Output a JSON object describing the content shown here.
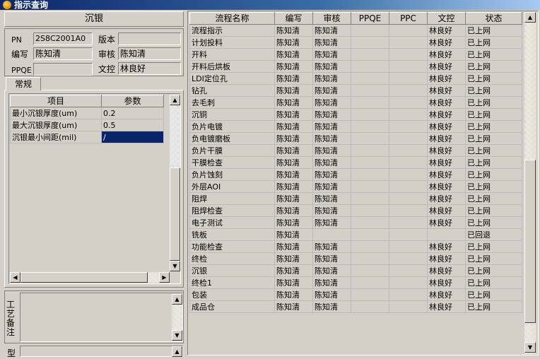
{
  "window": {
    "title": "指示查询"
  },
  "left": {
    "header": "沉银",
    "pn_label": "PN",
    "pn_value": "2S8C2001A0",
    "version_label": "版本",
    "version_value": "",
    "writer_label": "编写",
    "writer_value": "陈知清",
    "reviewer_label": "审核",
    "reviewer_value": "陈知清",
    "ppqe_label": "PPQE",
    "ppqe_value": "",
    "qc_label": "文控",
    "qc_value": "林良好",
    "tab_general": "常规",
    "param_columns": [
      "项目",
      "参数"
    ],
    "params": [
      {
        "item": "最小沉银厚度(um)",
        "value": "0.2"
      },
      {
        "item": "最大沉银厚度(um)",
        "value": "0.5"
      },
      {
        "item": "沉银最小间距(mil)",
        "value": "/"
      }
    ],
    "remarks_label": "工艺备注",
    "model_label": "型"
  },
  "flow": {
    "columns": [
      "流程名称",
      "编写",
      "审核",
      "PPQE",
      "PPC",
      "文控",
      "状态"
    ],
    "rows": [
      {
        "name": "流程指示",
        "writer": "陈知清",
        "reviewer": "陈知清",
        "ppqe": "",
        "ppc": "",
        "qc": "林良好",
        "status": "已上网"
      },
      {
        "name": "计划投料",
        "writer": "陈知清",
        "reviewer": "陈知清",
        "ppqe": "",
        "ppc": "",
        "qc": "林良好",
        "status": "已上网"
      },
      {
        "name": "开料",
        "writer": "陈知清",
        "reviewer": "陈知清",
        "ppqe": "",
        "ppc": "",
        "qc": "林良好",
        "status": "已上网"
      },
      {
        "name": "开料后烘板",
        "writer": "陈知清",
        "reviewer": "陈知清",
        "ppqe": "",
        "ppc": "",
        "qc": "林良好",
        "status": "已上网"
      },
      {
        "name": "LDI定位孔",
        "writer": "陈知清",
        "reviewer": "陈知清",
        "ppqe": "",
        "ppc": "",
        "qc": "林良好",
        "status": "已上网"
      },
      {
        "name": "钻孔",
        "writer": "陈知清",
        "reviewer": "陈知清",
        "ppqe": "",
        "ppc": "",
        "qc": "林良好",
        "status": "已上网"
      },
      {
        "name": "去毛刺",
        "writer": "陈知清",
        "reviewer": "陈知清",
        "ppqe": "",
        "ppc": "",
        "qc": "林良好",
        "status": "已上网"
      },
      {
        "name": "沉铜",
        "writer": "陈知清",
        "reviewer": "陈知清",
        "ppqe": "",
        "ppc": "",
        "qc": "林良好",
        "status": "已上网"
      },
      {
        "name": "负片电镀",
        "writer": "陈知清",
        "reviewer": "陈知清",
        "ppqe": "",
        "ppc": "",
        "qc": "林良好",
        "status": "已上网"
      },
      {
        "name": "负电镀磨板",
        "writer": "陈知清",
        "reviewer": "陈知清",
        "ppqe": "",
        "ppc": "",
        "qc": "林良好",
        "status": "已上网"
      },
      {
        "name": "负片干膜",
        "writer": "陈知清",
        "reviewer": "陈知清",
        "ppqe": "",
        "ppc": "",
        "qc": "林良好",
        "status": "已上网"
      },
      {
        "name": "干膜检查",
        "writer": "陈知清",
        "reviewer": "陈知清",
        "ppqe": "",
        "ppc": "",
        "qc": "林良好",
        "status": "已上网"
      },
      {
        "name": "负片蚀刻",
        "writer": "陈知清",
        "reviewer": "陈知清",
        "ppqe": "",
        "ppc": "",
        "qc": "林良好",
        "status": "已上网"
      },
      {
        "name": "外层AOI",
        "writer": "陈知清",
        "reviewer": "陈知清",
        "ppqe": "",
        "ppc": "",
        "qc": "林良好",
        "status": "已上网"
      },
      {
        "name": "阻焊",
        "writer": "陈知清",
        "reviewer": "陈知清",
        "ppqe": "",
        "ppc": "",
        "qc": "林良好",
        "status": "已上网"
      },
      {
        "name": "阻焊检查",
        "writer": "陈知清",
        "reviewer": "陈知清",
        "ppqe": "",
        "ppc": "",
        "qc": "林良好",
        "status": "已上网"
      },
      {
        "name": "电子测试",
        "writer": "陈知清",
        "reviewer": "陈知清",
        "ppqe": "",
        "ppc": "",
        "qc": "林良好",
        "status": "已上网"
      },
      {
        "name": "铣板",
        "writer": "陈知清",
        "reviewer": "",
        "ppqe": "",
        "ppc": "",
        "qc": "",
        "status": "已回退"
      },
      {
        "name": "功能检查",
        "writer": "陈知清",
        "reviewer": "陈知清",
        "ppqe": "",
        "ppc": "",
        "qc": "林良好",
        "status": "已上网"
      },
      {
        "name": "终检",
        "writer": "陈知清",
        "reviewer": "陈知清",
        "ppqe": "",
        "ppc": "",
        "qc": "林良好",
        "status": "已上网"
      },
      {
        "name": "沉银",
        "writer": "陈知清",
        "reviewer": "陈知清",
        "ppqe": "",
        "ppc": "",
        "qc": "林良好",
        "status": "已上网"
      },
      {
        "name": "终检1",
        "writer": "陈知清",
        "reviewer": "陈知清",
        "ppqe": "",
        "ppc": "",
        "qc": "林良好",
        "status": "已上网"
      },
      {
        "name": "包装",
        "writer": "陈知清",
        "reviewer": "陈知清",
        "ppqe": "",
        "ppc": "",
        "qc": "林良好",
        "status": "已上网"
      },
      {
        "name": "成品仓",
        "writer": "陈知清",
        "reviewer": "陈知清",
        "ppqe": "",
        "ppc": "",
        "qc": "林良好",
        "status": "已上网"
      }
    ]
  }
}
